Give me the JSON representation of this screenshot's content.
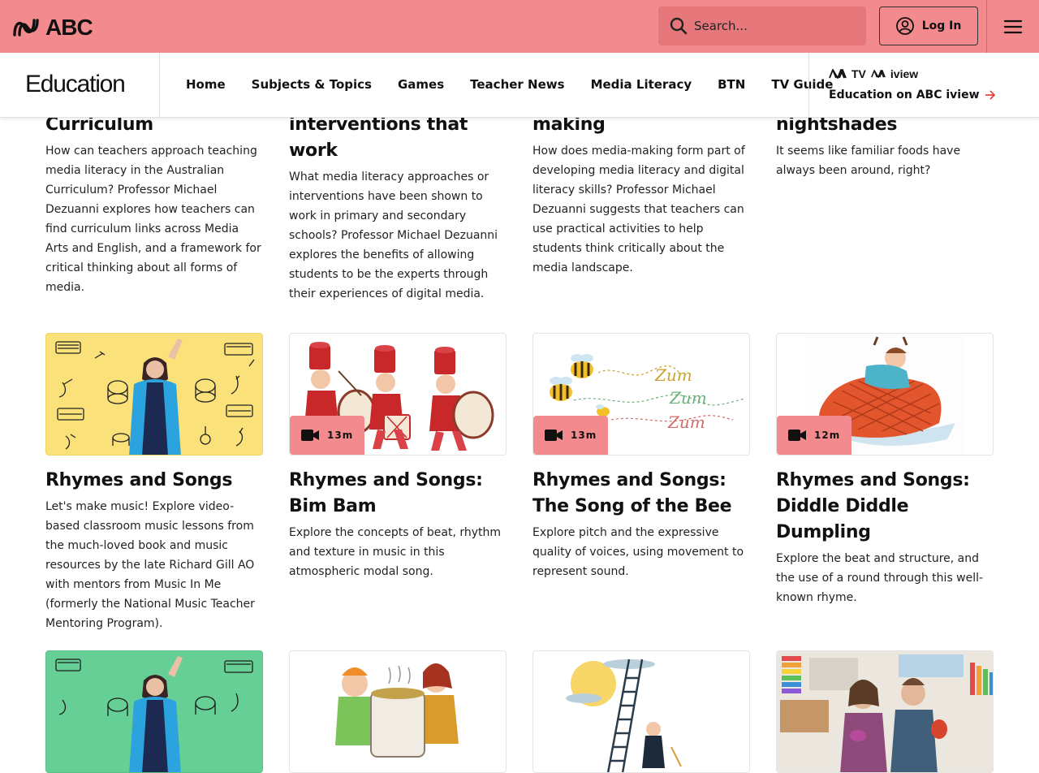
{
  "topbar": {
    "logo_text": "ABC",
    "search_placeholder": "Search...",
    "login_label": "Log In"
  },
  "subnav": {
    "section_title": "Education",
    "links": [
      "Home",
      "Subjects & Topics",
      "Games",
      "Teacher News",
      "Media Literacy",
      "BTN",
      "TV Guide"
    ],
    "iview_logo_tv": "TV",
    "iview_logo_iview": "iview",
    "iview_link": "Education on ABC iview"
  },
  "row1": [
    {
      "title_line": "Curriculum",
      "description": "How can teachers approach teaching media literacy in the Australian Curriculum?  Professor Michael Dezuanni explores how teachers can find curriculum links across Media Arts and English, and a framework for critical thinking about all forms of media."
    },
    {
      "title_line": "interventions that work",
      "description": "What media literacy approaches or interventions have been shown to work in primary and secondary schools? Professor Michael Dezuanni explores the benefits of allowing students to be the experts through their experiences of digital media."
    },
    {
      "title_line": "making",
      "description": "How does media-making form part of developing media literacy and digital literacy skills? Professor Michael Dezuanni suggests that teachers can use practical activities to help students think critically about the media landscape."
    },
    {
      "title_line": "nightshades",
      "description": "It seems like familiar foods have always been around, right?"
    }
  ],
  "row2": [
    {
      "title": "Rhymes and Songs",
      "description": "Let's make music! Explore video-based classroom music lessons from the much-loved book and music resources by the late Richard Gill AO with mentors from Music In Me (formerly the National Music Teacher Mentoring Program).",
      "duration": ""
    },
    {
      "title": "Rhymes and Songs: Bim Bam",
      "description": "Explore the concepts of beat, rhythm and texture in music in this atmospheric modal song.",
      "duration": "13m"
    },
    {
      "title": "Rhymes and Songs: The Song of the Bee",
      "description": "Explore pitch and the expressive quality of voices, using movement to represent sound.",
      "duration": "13m",
      "art_text": "Zum"
    },
    {
      "title": "Rhymes and Songs: Diddle Diddle Dumpling",
      "description": "Explore the beat and structure, and the use of a round through this well-known rhyme.",
      "duration": "12m"
    }
  ],
  "colors": {
    "brand_pink": "#f28a8e",
    "search_bg": "#e6787c",
    "thumb_yellow": "#fbe17a",
    "thumb_green": "#66cf96"
  }
}
